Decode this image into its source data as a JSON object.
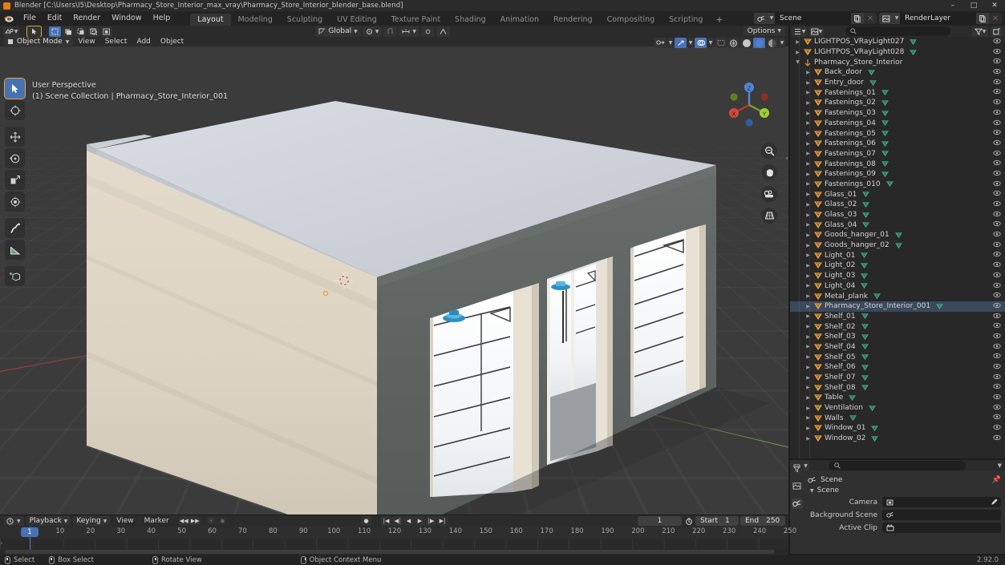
{
  "window": {
    "title": "Blender [C:\\Users\\I5\\Desktop\\Pharmacy_Store_Interior_max_vray\\Pharmacy_Store_Interior_blender_base.blend]",
    "app_icon": "blender-icon",
    "minimize": "–",
    "maximize": "□",
    "close": "✕"
  },
  "topbar": {
    "menus": [
      "File",
      "Edit",
      "Render",
      "Window",
      "Help"
    ],
    "workspace_tabs": [
      {
        "label": "Layout",
        "active": true
      },
      {
        "label": "Modeling",
        "active": false
      },
      {
        "label": "Sculpting",
        "active": false
      },
      {
        "label": "UV Editing",
        "active": false
      },
      {
        "label": "Texture Paint",
        "active": false
      },
      {
        "label": "Shading",
        "active": false
      },
      {
        "label": "Animation",
        "active": false
      },
      {
        "label": "Rendering",
        "active": false
      },
      {
        "label": "Compositing",
        "active": false
      },
      {
        "label": "Scripting",
        "active": false
      }
    ],
    "add_workspace": "+",
    "scene_name": "Scene",
    "view_layer_name": "RenderLayer"
  },
  "viewport": {
    "mode": "Object Mode",
    "menus": [
      "View",
      "Select",
      "Add",
      "Object"
    ],
    "transform_orientation": "Global",
    "options_label": "Options",
    "overlay_line1": "User Perspective",
    "overlay_line2": "(1) Scene Collection | Pharmacy_Store_Interior_001",
    "gizmo_axes": {
      "x": "X",
      "y": "Y",
      "z": "Z"
    },
    "tools": [
      "tweak-select-tool",
      "cursor-tool",
      "move-tool",
      "rotate-tool",
      "scale-tool",
      "transform-tool",
      "annotate-tool",
      "measure-tool",
      "add-cube-tool"
    ],
    "nav_buttons": [
      "zoom-icon",
      "pan-hand-icon",
      "camera-view-icon",
      "orthographic-toggle-icon"
    ],
    "shading_modes": [
      "wireframe",
      "solid",
      "material-preview",
      "rendered"
    ],
    "active_shading": "solid"
  },
  "outliner": {
    "search_placeholder": "",
    "display_mode": "View Layer",
    "items": [
      {
        "name": "LIGHTPOS_VRayLight027",
        "indent": 1,
        "icon": "object-mesh",
        "mesh": true,
        "expandable": true
      },
      {
        "name": "LIGHTPOS_VRayLight028",
        "indent": 1,
        "icon": "object-mesh",
        "mesh": true,
        "expandable": true
      },
      {
        "name": "Pharmacy_Store_Interior",
        "indent": 1,
        "icon": "object-empty",
        "mesh": false,
        "expandable": true,
        "expanded": true
      },
      {
        "name": "Back_door",
        "indent": 2,
        "icon": "object-mesh",
        "mesh": true,
        "expandable": true
      },
      {
        "name": "Entry_door",
        "indent": 2,
        "icon": "object-mesh",
        "mesh": true,
        "expandable": true
      },
      {
        "name": "Fastenings_01",
        "indent": 2,
        "icon": "object-mesh",
        "mesh": true,
        "expandable": true
      },
      {
        "name": "Fastenings_02",
        "indent": 2,
        "icon": "object-mesh",
        "mesh": true,
        "expandable": true
      },
      {
        "name": "Fastenings_03",
        "indent": 2,
        "icon": "object-mesh",
        "mesh": true,
        "expandable": true
      },
      {
        "name": "Fastenings_04",
        "indent": 2,
        "icon": "object-mesh",
        "mesh": true,
        "expandable": true
      },
      {
        "name": "Fastenings_05",
        "indent": 2,
        "icon": "object-mesh",
        "mesh": true,
        "expandable": true
      },
      {
        "name": "Fastenings_06",
        "indent": 2,
        "icon": "object-mesh",
        "mesh": true,
        "expandable": true
      },
      {
        "name": "Fastenings_07",
        "indent": 2,
        "icon": "object-mesh",
        "mesh": true,
        "expandable": true
      },
      {
        "name": "Fastenings_08",
        "indent": 2,
        "icon": "object-mesh",
        "mesh": true,
        "expandable": true
      },
      {
        "name": "Fastenings_09",
        "indent": 2,
        "icon": "object-mesh",
        "mesh": true,
        "expandable": true
      },
      {
        "name": "Fastenings_010",
        "indent": 2,
        "icon": "object-mesh",
        "mesh": true,
        "expandable": true
      },
      {
        "name": "Glass_01",
        "indent": 2,
        "icon": "object-mesh",
        "mesh": true,
        "expandable": true
      },
      {
        "name": "Glass_02",
        "indent": 2,
        "icon": "object-mesh",
        "mesh": true,
        "expandable": true
      },
      {
        "name": "Glass_03",
        "indent": 2,
        "icon": "object-mesh",
        "mesh": true,
        "expandable": true
      },
      {
        "name": "Glass_04",
        "indent": 2,
        "icon": "object-mesh",
        "mesh": true,
        "expandable": true
      },
      {
        "name": "Goods_hanger_01",
        "indent": 2,
        "icon": "object-mesh",
        "mesh": true,
        "expandable": true
      },
      {
        "name": "Goods_hanger_02",
        "indent": 2,
        "icon": "object-mesh",
        "mesh": true,
        "expandable": true
      },
      {
        "name": "Light_01",
        "indent": 2,
        "icon": "object-mesh",
        "mesh": true,
        "expandable": true
      },
      {
        "name": "Light_02",
        "indent": 2,
        "icon": "object-mesh",
        "mesh": true,
        "expandable": true
      },
      {
        "name": "Light_03",
        "indent": 2,
        "icon": "object-mesh",
        "mesh": true,
        "expandable": true
      },
      {
        "name": "Light_04",
        "indent": 2,
        "icon": "object-mesh",
        "mesh": true,
        "expandable": true
      },
      {
        "name": "Metal_plank",
        "indent": 2,
        "icon": "object-mesh",
        "mesh": true,
        "expandable": true
      },
      {
        "name": "Pharmacy_Store_Interior_001",
        "indent": 2,
        "icon": "object-mesh",
        "mesh": true,
        "expandable": true,
        "selected": true
      },
      {
        "name": "Shelf_01",
        "indent": 2,
        "icon": "object-mesh",
        "mesh": true,
        "expandable": true
      },
      {
        "name": "Shelf_02",
        "indent": 2,
        "icon": "object-mesh",
        "mesh": true,
        "expandable": true
      },
      {
        "name": "Shelf_03",
        "indent": 2,
        "icon": "object-mesh",
        "mesh": true,
        "expandable": true
      },
      {
        "name": "Shelf_04",
        "indent": 2,
        "icon": "object-mesh",
        "mesh": true,
        "expandable": true
      },
      {
        "name": "Shelf_05",
        "indent": 2,
        "icon": "object-mesh",
        "mesh": true,
        "expandable": true
      },
      {
        "name": "Shelf_06",
        "indent": 2,
        "icon": "object-mesh",
        "mesh": true,
        "expandable": true
      },
      {
        "name": "Shelf_07",
        "indent": 2,
        "icon": "object-mesh",
        "mesh": true,
        "expandable": true
      },
      {
        "name": "Shelf_08",
        "indent": 2,
        "icon": "object-mesh",
        "mesh": true,
        "expandable": true
      },
      {
        "name": "Table",
        "indent": 2,
        "icon": "object-mesh",
        "mesh": true,
        "expandable": true
      },
      {
        "name": "Ventilation",
        "indent": 2,
        "icon": "object-mesh",
        "mesh": true,
        "expandable": true
      },
      {
        "name": "Walls",
        "indent": 2,
        "icon": "object-mesh",
        "mesh": true,
        "expandable": true
      },
      {
        "name": "Window_01",
        "indent": 2,
        "icon": "object-mesh",
        "mesh": true,
        "expandable": true
      },
      {
        "name": "Window_02",
        "indent": 2,
        "icon": "object-mesh",
        "mesh": true,
        "expandable": true
      }
    ]
  },
  "properties": {
    "search_placeholder": "",
    "breadcrumb": "Scene",
    "panel_title": "Scene",
    "tabs": [
      "tool-tab",
      "render-tab",
      "output-tab",
      "view-layer-tab",
      "scene-tab"
    ],
    "active_tab": "scene-tab",
    "fields": [
      {
        "label": "Camera",
        "value": "",
        "icon": "camera-icon"
      },
      {
        "label": "Background Scene",
        "value": "",
        "icon": "scene-icon"
      },
      {
        "label": "Active Clip",
        "value": "",
        "icon": "clip-icon"
      }
    ]
  },
  "timeline": {
    "editor_type": "timeline-icon",
    "menus": [
      "Playback",
      "Keying",
      "View",
      "Marker"
    ],
    "current_frame": "1",
    "start_label": "Start",
    "start_value": "1",
    "end_label": "End",
    "end_value": "250",
    "ticks": [
      "10",
      "20",
      "30",
      "40",
      "50",
      "60",
      "70",
      "80",
      "90",
      "100",
      "110",
      "120",
      "130",
      "140",
      "150",
      "160",
      "170",
      "180",
      "190",
      "200",
      "210",
      "220",
      "230",
      "240",
      "250"
    ],
    "playhead_label": "1",
    "transport": [
      "jump-start",
      "prev-keyframe",
      "play-reverse",
      "play",
      "next-keyframe",
      "jump-end"
    ]
  },
  "statusbar": {
    "hints": [
      {
        "icon": "lmb-icon",
        "label": "Select"
      },
      {
        "icon": "lmb-drag-icon",
        "label": "Box Select"
      },
      {
        "icon": "mmb-icon",
        "label": "Rotate View"
      },
      {
        "icon": "rmb-icon",
        "label": "Object Context Menu"
      }
    ],
    "version": "2.92.0"
  },
  "colors": {
    "accent": "#4772b3",
    "wall_light": "#ded3c2",
    "wall_dark": "#5b6260",
    "roof": "#c9cdd4",
    "grid_bg": "#3b3b3b",
    "orange_icon": "#e09a3e",
    "mesh_green": "#3f9e7e"
  }
}
